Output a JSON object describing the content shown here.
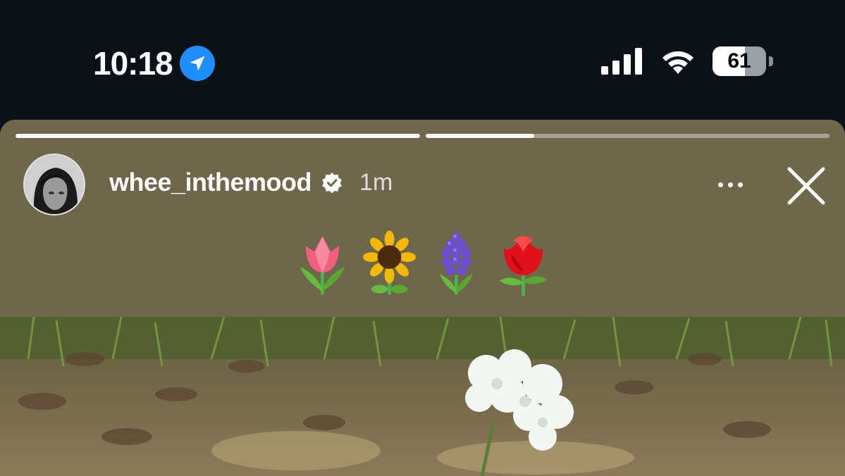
{
  "status_bar": {
    "time": "10:18",
    "location_icon": "location-arrow-icon",
    "cellular_icon": "cellular-signal-icon",
    "wifi_icon": "wifi-icon",
    "battery_level": "61",
    "battery_percent": 61
  },
  "story": {
    "progress_segments": [
      1.0,
      0.27
    ],
    "username": "whee_inthemood",
    "verified_icon": "verified-badge-icon",
    "time_ago": "1m",
    "more_icon": "more-horizontal-icon",
    "close_icon": "close-icon",
    "emojis": [
      "tulip",
      "sunflower",
      "hyacinth",
      "rose"
    ],
    "background_color": "#6e674b"
  }
}
